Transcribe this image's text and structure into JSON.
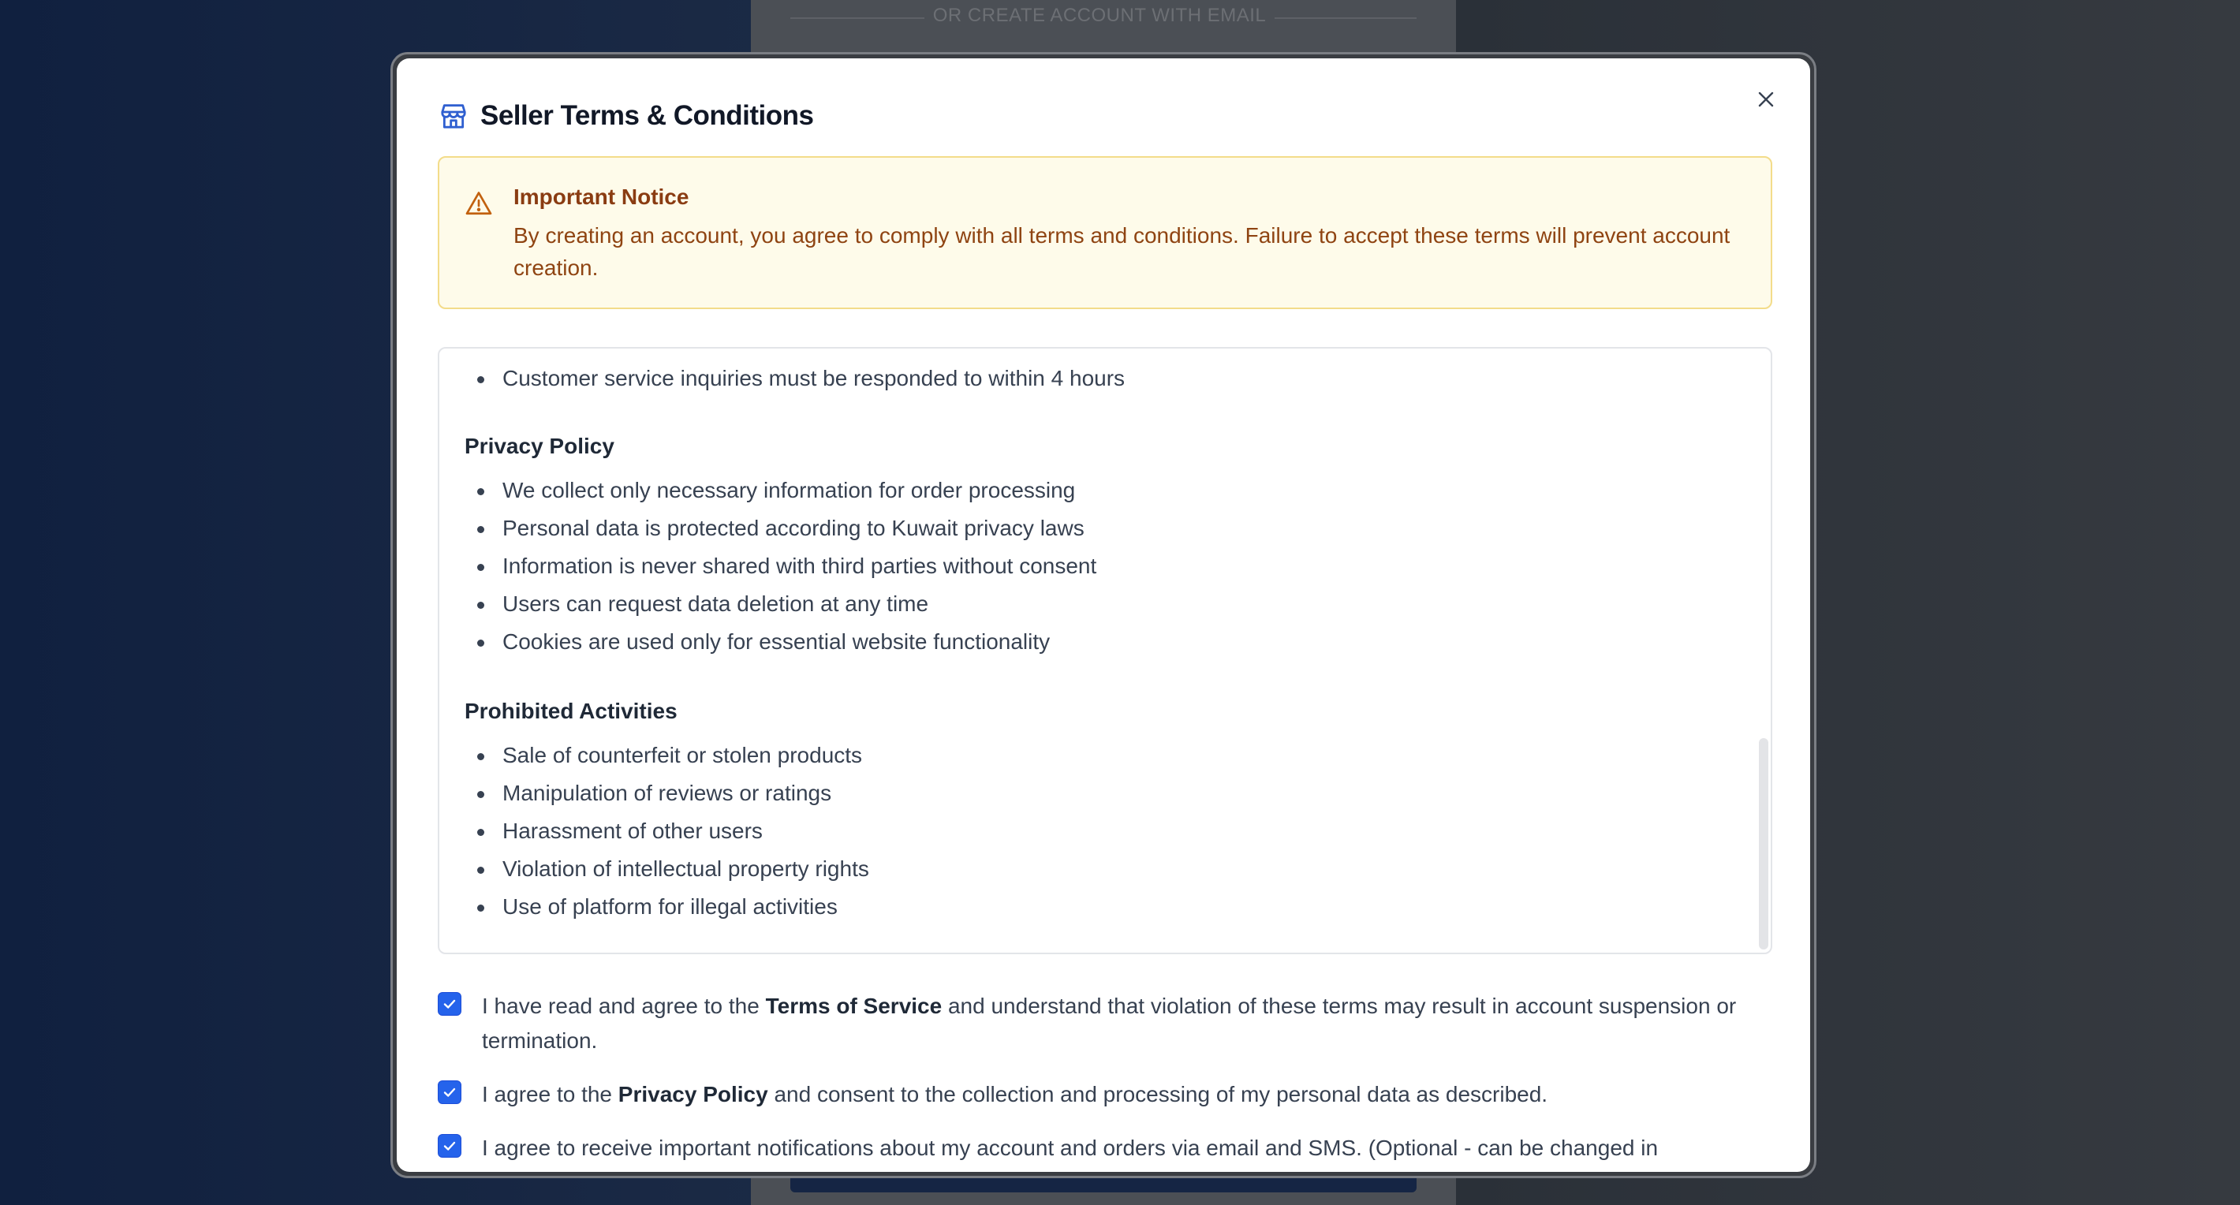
{
  "background": {
    "divider_text": "OR CREATE ACCOUNT WITH EMAIL"
  },
  "modal": {
    "title": "Seller Terms & Conditions",
    "title_icon": "store-icon",
    "close_icon": "close-icon"
  },
  "notice": {
    "icon": "warning-triangle-icon",
    "title": "Important Notice",
    "body": "By creating an account, you agree to comply with all terms and conditions. Failure to accept these terms will prevent account creation."
  },
  "terms": {
    "partial_item": "Customer service inquiries must be responded to within 4 hours",
    "privacy": {
      "heading": "Privacy Policy",
      "items": [
        "We collect only necessary information for order processing",
        "Personal data is protected according to Kuwait privacy laws",
        "Information is never shared with third parties without consent",
        "Users can request data deletion at any time",
        "Cookies are used only for essential website functionality"
      ]
    },
    "prohibited": {
      "heading": "Prohibited Activities",
      "items": [
        "Sale of counterfeit or stolen products",
        "Manipulation of reviews or ratings",
        "Harassment of other users",
        "Violation of intellectual property rights",
        "Use of platform for illegal activities"
      ]
    }
  },
  "agreements": [
    {
      "checked": true,
      "before": "I have read and agree to the ",
      "bold": "Terms of Service",
      "after": " and understand that violation of these terms may result in account suspension or termination."
    },
    {
      "checked": true,
      "before": "I agree to the ",
      "bold": "Privacy Policy",
      "after": " and consent to the collection and processing of my personal data as described."
    },
    {
      "checked": true,
      "before": "I agree to receive important notifications about my account and orders via email and SMS. (Optional - can be changed in",
      "bold": "",
      "after": ""
    }
  ],
  "colors": {
    "accent": "#2563eb",
    "notice_bg": "#fefbea",
    "notice_text": "#8f4412"
  }
}
